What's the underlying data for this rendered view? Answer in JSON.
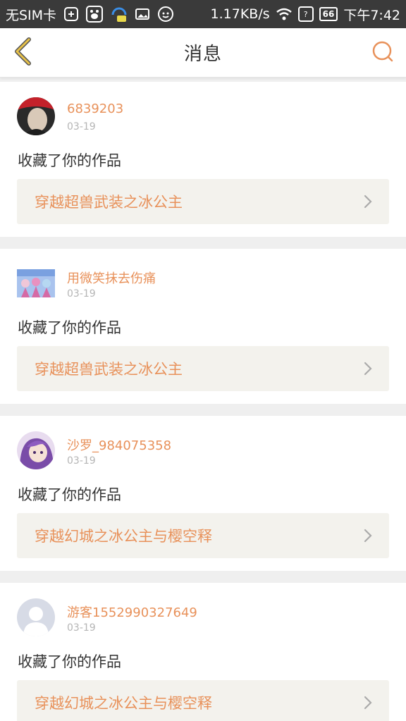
{
  "status_bar": {
    "carrier": "无SIM卡",
    "speed": "1.17KB/s",
    "battery": "66",
    "time": "下午7:42"
  },
  "header": {
    "title": "消息"
  },
  "notifications": [
    {
      "username": "6839203",
      "date": "03-19",
      "action": "收藏了你的作品",
      "work_title": "穿越超兽武装之冰公主"
    },
    {
      "username": "用微笑抹去伤痛",
      "date": "03-19",
      "action": "收藏了你的作品",
      "work_title": "穿越超兽武装之冰公主"
    },
    {
      "username": "沙罗_984075358",
      "date": "03-19",
      "action": "收藏了你的作品",
      "work_title": "穿越幻城之冰公主与樱空释"
    },
    {
      "username": "游客1552990327649",
      "date": "03-19",
      "action": "收藏了你的作品",
      "work_title": "穿越幻城之冰公主与樱空释"
    }
  ],
  "colors": {
    "accent": "#e8915a",
    "back_arrow": "#e8c24a",
    "card_link_bg": "#f3f2ed",
    "page_bg": "#efefef"
  }
}
